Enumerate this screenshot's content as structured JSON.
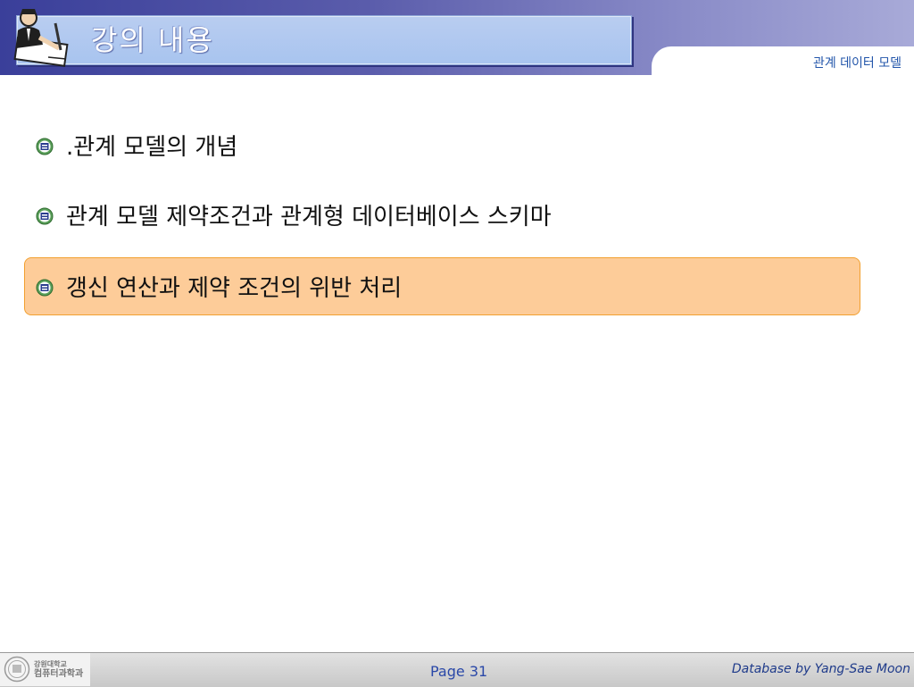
{
  "header": {
    "title": "강의 내용",
    "section_tab": "관계 데이터 모델"
  },
  "main": {
    "items": [
      {
        "label": ".관계 모델의 개념",
        "highlighted": false
      },
      {
        "label": "관계 모델 제약조건과 관계형 데이터베이스 스키마",
        "highlighted": false
      },
      {
        "label": "갱신 연산과 제약 조건의 위반 처리",
        "highlighted": true
      }
    ]
  },
  "footer": {
    "logo_line1": "강원대학교",
    "logo_line2": "컴퓨터과학과",
    "page": "Page 31",
    "credit": "Database by Yang-Sae Moon"
  },
  "colors": {
    "header_dark": "#3a3f9a",
    "title_box": "#a8c4ef",
    "highlight_fill": "#fdcc99",
    "highlight_border": "#f2a030",
    "tab_text": "#2255aa"
  },
  "icons": {
    "header": "teacher-writing-icon",
    "bullet": "university-emblem-icon"
  }
}
